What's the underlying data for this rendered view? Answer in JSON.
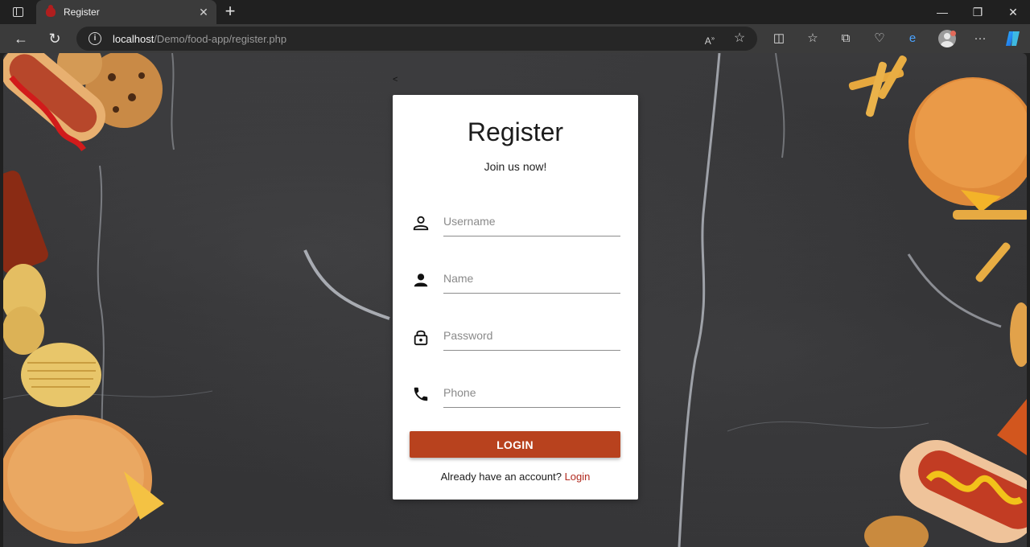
{
  "browser": {
    "tab_title": "Register",
    "url_host": "localhost",
    "url_path": "/Demo/food-app/register.php"
  },
  "page": {
    "back_text": "<",
    "title": "Register",
    "subtitle": "Join us now!",
    "fields": [
      {
        "icon": "person-outline-icon",
        "placeholder": "Username",
        "value": ""
      },
      {
        "icon": "person-icon",
        "placeholder": "Name",
        "value": ""
      },
      {
        "icon": "lock-icon",
        "placeholder": "Password",
        "value": ""
      },
      {
        "icon": "phone-icon",
        "placeholder": "Phone",
        "value": ""
      }
    ],
    "submit_label": "LOGIN",
    "footer_text": "Already have an account?",
    "footer_link": "Login"
  },
  "colors": {
    "accent": "#b8421e",
    "link": "#b12a1f",
    "card": "#ffffff",
    "background": "#323234"
  }
}
